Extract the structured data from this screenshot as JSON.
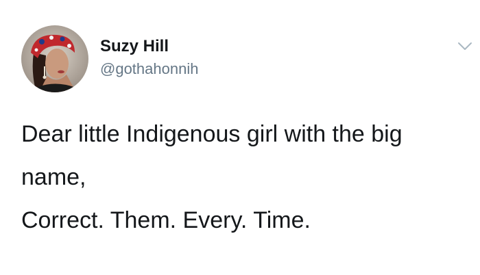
{
  "author": {
    "display_name": "Suzy Hill",
    "handle": "@gothahonnih"
  },
  "menu": {
    "icon": "chevron-down-icon"
  },
  "tweet": {
    "lines": [
      "Dear little Indigenous girl with the big",
      "name,",
      "Correct. Them. Every. Time."
    ]
  },
  "colors": {
    "text": "#14171a",
    "handle": "#657786",
    "caret": "#aab8c2",
    "background": "#ffffff"
  }
}
